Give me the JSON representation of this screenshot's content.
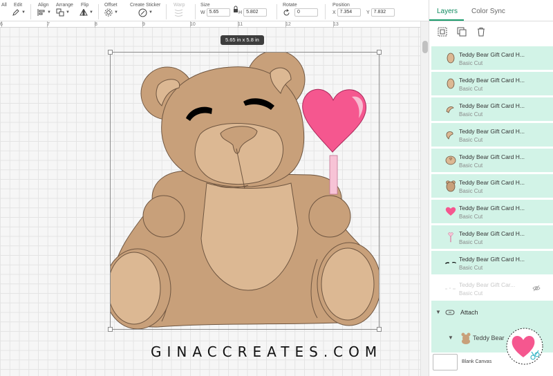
{
  "toolbar": {
    "select_all": "All",
    "edit": "Edit",
    "align": "Align",
    "arrange": "Arrange",
    "flip": "Flip",
    "offset": "Offset",
    "create_sticker": "Create Sticker",
    "warp": "Warp",
    "size": "Size",
    "width_label": "W",
    "width_value": "5.65",
    "height_label": "H",
    "height_value": "5.802",
    "rotate": "Rotate",
    "rotate_value": "0",
    "position": "Position",
    "x_label": "X",
    "x_value": "7.354",
    "y_label": "Y",
    "y_value": "7.832"
  },
  "ruler": {
    "ticks": [
      "6",
      "7",
      "8",
      "9",
      "10",
      "11",
      "12",
      "13"
    ]
  },
  "canvas": {
    "size_tooltip": "5.65  in x 5.8  in"
  },
  "watermark": "GINACCREATES.COM",
  "panel": {
    "tabs": [
      "Layers",
      "Color Sync"
    ],
    "actions": [
      "group-icon",
      "duplicate-icon",
      "delete-icon"
    ],
    "layers": [
      {
        "name": "Teddy Bear Gift Card H...",
        "type": "Basic Cut",
        "icon": "oval-shape"
      },
      {
        "name": "Teddy Bear Gift Card H...",
        "type": "Basic Cut",
        "icon": "oval-shape"
      },
      {
        "name": "Teddy Bear Gift Card H...",
        "type": "Basic Cut",
        "icon": "ear-shape"
      },
      {
        "name": "Teddy Bear Gift Card H...",
        "type": "Basic Cut",
        "icon": "ear-shape"
      },
      {
        "name": "Teddy Bear Gift Card H...",
        "type": "Basic Cut",
        "icon": "muzzle-shape"
      },
      {
        "name": "Teddy Bear Gift Card H...",
        "type": "Basic Cut",
        "icon": "bear-shape"
      },
      {
        "name": "Teddy Bear Gift Card H...",
        "type": "Basic Cut",
        "icon": "heart-shape"
      },
      {
        "name": "Teddy Bear Gift Card H...",
        "type": "Basic Cut",
        "icon": "lollipop-shape"
      },
      {
        "name": "Teddy Bear Gift Card H...",
        "type": "Basic Cut",
        "icon": "eyes-shape"
      },
      {
        "name": "Teddy Bear Gift Car...",
        "type": "Basic Cut",
        "icon": "lines-shape",
        "hidden": true
      }
    ],
    "attach": "Attach",
    "group_label": "Teddy Bear",
    "blank_canvas": "Blank Canvas"
  },
  "colors": {
    "accent": "#1a9b6c",
    "layer_row_bg": "#d2f3e7",
    "bear_dark": "#c8a07a",
    "bear_light": "#dcb893",
    "lollipop_pink": "#f5578f",
    "stick_pink": "#f7c3d6"
  }
}
